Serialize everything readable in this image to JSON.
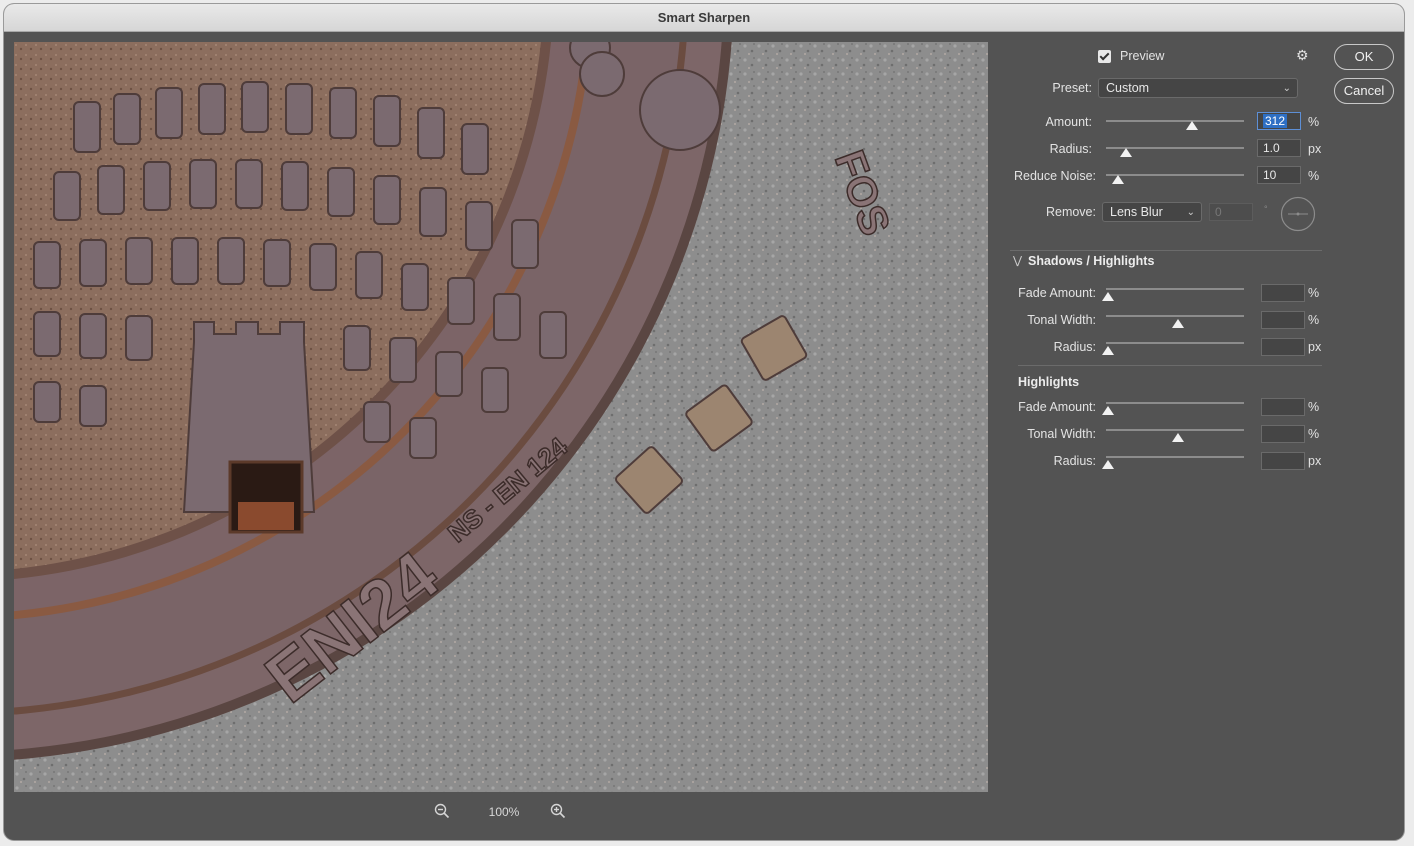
{
  "window": {
    "title": "Smart Sharpen"
  },
  "preview": {
    "zoom_label": "100%",
    "cover_texts": [
      "ENI24",
      "NS - EN 124",
      "FOS"
    ]
  },
  "panel": {
    "preview_label": "Preview",
    "preview_checked": true,
    "ok_label": "OK",
    "cancel_label": "Cancel",
    "preset_label": "Preset:",
    "preset_value": "Custom",
    "amount": {
      "label": "Amount:",
      "value": "312",
      "unit": "%"
    },
    "radius": {
      "label": "Radius:",
      "value": "1.0",
      "unit": "px"
    },
    "reduce_noise": {
      "label": "Reduce Noise:",
      "value": "10",
      "unit": "%"
    },
    "remove": {
      "label": "Remove:",
      "value": "Lens Blur",
      "angle_value": "0",
      "angle_unit": "°"
    },
    "shadows_highlights_title": "Shadows / Highlights",
    "shadows": {
      "fade_amount": {
        "label": "Fade Amount:",
        "unit": "%"
      },
      "tonal_width": {
        "label": "Tonal Width:",
        "unit": "%"
      },
      "radius": {
        "label": "Radius:",
        "unit": "px"
      }
    },
    "highlights_title": "Highlights",
    "highlights": {
      "fade_amount": {
        "label": "Fade Amount:",
        "unit": "%"
      },
      "tonal_width": {
        "label": "Tonal Width:",
        "unit": "%"
      },
      "radius": {
        "label": "Radius:",
        "unit": "px"
      }
    }
  },
  "colors": {
    "panel_bg": "#535353",
    "selection": "#2e6fc4",
    "metal": "#7a6468",
    "rust": "#8a5a42",
    "asphalt": "#8e8e8e"
  },
  "icons": {
    "zoom_out": "zoom-out-icon",
    "zoom_in": "zoom-in-icon",
    "gear": "gear-icon",
    "expand": "chevron-down-icon"
  }
}
